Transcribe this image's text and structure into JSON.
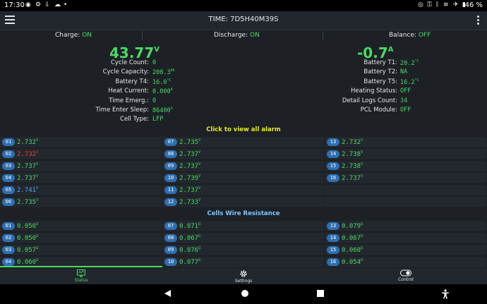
{
  "statusbar": {
    "time": "17:30",
    "battery": "46 %"
  },
  "header": {
    "title": "TIME: 7D5H40M39S"
  },
  "status_row": {
    "charge_label": "Charge:",
    "charge_value": "ON",
    "discharge_label": "Discharge:",
    "discharge_value": "ON",
    "balance_label": "Balance:",
    "balance_value": "OFF"
  },
  "voltage": {
    "value": "43.77",
    "unit": "V"
  },
  "current": {
    "value": "-0.7",
    "unit": "A"
  },
  "left_info": [
    {
      "label": "Cycle Count:",
      "value": "0",
      "unit": ""
    },
    {
      "label": "Cycle Capacity:",
      "value": "208.3",
      "unit": "Ah"
    },
    {
      "label": "Battery T4:",
      "value": "16.0",
      "unit": "°C"
    },
    {
      "label": "Heat Current:",
      "value": "0.000",
      "unit": "A"
    },
    {
      "label": "Time Emerg.:",
      "value": "0",
      "unit": ""
    },
    {
      "label": "Time Enter Sleep:",
      "value": "86400",
      "unit": "S"
    },
    {
      "label": "Cell Type:",
      "value": "LFP",
      "unit": ""
    }
  ],
  "right_info": [
    {
      "label": "Battery T1:",
      "value": "20.2",
      "unit": "°C"
    },
    {
      "label": "Battery T2:",
      "value": "NA",
      "unit": ""
    },
    {
      "label": "Battery T5:",
      "value": "16.2",
      "unit": "°C"
    },
    {
      "label": "Heating Status:",
      "value": "OFF",
      "unit": ""
    },
    {
      "label": "Detail Logs Count:",
      "value": "34",
      "unit": ""
    },
    {
      "label": "PCL Module:",
      "value": "OFF",
      "unit": ""
    }
  ],
  "alarm_link": "Click to view all alarm",
  "cells": {
    "col1": [
      {
        "id": "01",
        "value": "2.732",
        "unit": "V",
        "color": "#4cd964"
      },
      {
        "id": "02",
        "value": "2.732",
        "unit": "V",
        "color": "#ff3b30"
      },
      {
        "id": "03",
        "value": "2.737",
        "unit": "V",
        "color": "#4cd964"
      },
      {
        "id": "04",
        "value": "2.737",
        "unit": "V",
        "color": "#4cd964"
      },
      {
        "id": "05",
        "value": "2.741",
        "unit": "V",
        "color": "#4aa3ff"
      },
      {
        "id": "06",
        "value": "2.735",
        "unit": "V",
        "color": "#4cd964"
      }
    ],
    "col2": [
      {
        "id": "07",
        "value": "2.735",
        "unit": "V",
        "color": "#4cd964"
      },
      {
        "id": "08",
        "value": "2.737",
        "unit": "V",
        "color": "#4cd964"
      },
      {
        "id": "09",
        "value": "2.737",
        "unit": "V",
        "color": "#4cd964"
      },
      {
        "id": "10",
        "value": "2.739",
        "unit": "V",
        "color": "#4cd964"
      },
      {
        "id": "11",
        "value": "2.737",
        "unit": "V",
        "color": "#4cd964"
      },
      {
        "id": "12",
        "value": "2.733",
        "unit": "V",
        "color": "#4cd964"
      }
    ],
    "col3": [
      {
        "id": "13",
        "value": "2.732",
        "unit": "V",
        "color": "#4cd964"
      },
      {
        "id": "14",
        "value": "2.738",
        "unit": "V",
        "color": "#4cd964"
      },
      {
        "id": "15",
        "value": "2.738",
        "unit": "V",
        "color": "#4cd964"
      },
      {
        "id": "16",
        "value": "2.737",
        "unit": "V",
        "color": "#4cd964"
      }
    ]
  },
  "resistance_title": "Cells Wire Resistance",
  "resistance": {
    "col1": [
      {
        "id": "01",
        "value": "0.050",
        "unit": "Ω"
      },
      {
        "id": "02",
        "value": "0.050",
        "unit": "Ω"
      },
      {
        "id": "03",
        "value": "0.057",
        "unit": "Ω"
      },
      {
        "id": "04",
        "value": "0.060",
        "unit": "Ω"
      }
    ],
    "col2": [
      {
        "id": "07",
        "value": "0.071",
        "unit": "Ω"
      },
      {
        "id": "08",
        "value": "0.067",
        "unit": "Ω"
      },
      {
        "id": "09",
        "value": "0.076",
        "unit": "Ω"
      },
      {
        "id": "10",
        "value": "0.077",
        "unit": "Ω"
      }
    ],
    "col3": [
      {
        "id": "13",
        "value": "0.079",
        "unit": "Ω"
      },
      {
        "id": "14",
        "value": "0.067",
        "unit": "Ω"
      },
      {
        "id": "15",
        "value": "0.060",
        "unit": "Ω"
      },
      {
        "id": "16",
        "value": "0.054",
        "unit": "Ω"
      }
    ]
  },
  "nav": {
    "status": "Status",
    "settings": "Settings",
    "control": "Control"
  },
  "colors": {
    "accent": "#4cd964",
    "link_yellow": "#e8e82a",
    "link_blue": "#7fc4ff"
  }
}
